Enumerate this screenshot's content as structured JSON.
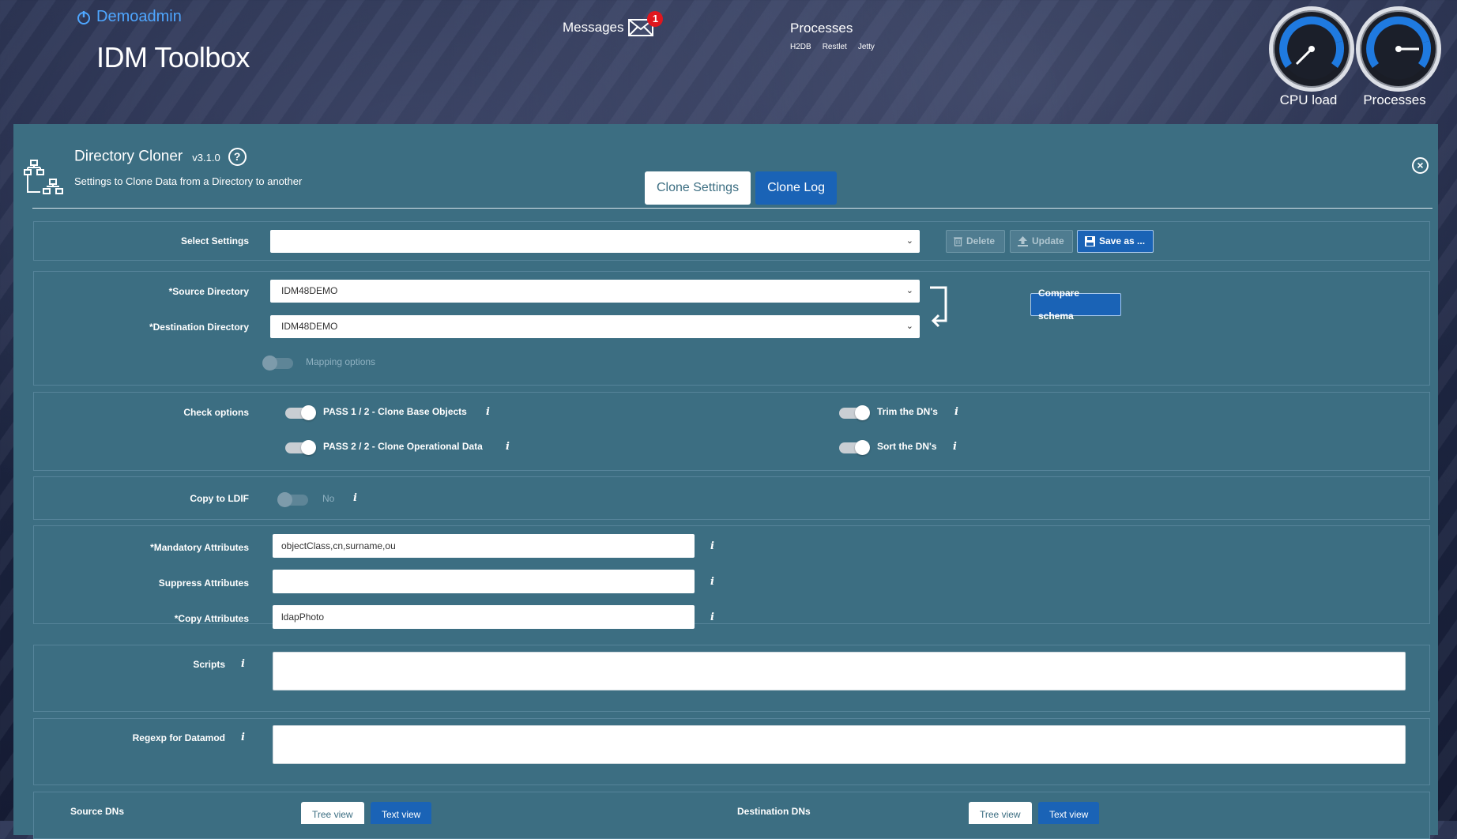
{
  "header": {
    "user": "Demoadmin",
    "app_title": "IDM Toolbox",
    "messages_label": "Messages",
    "messages_count": "1",
    "processes_title": "Processes",
    "process_items": [
      "H2DB",
      "Restlet",
      "Jetty"
    ],
    "gauges": [
      {
        "label": "CPU load",
        "level": 0.2
      },
      {
        "label": "Processes",
        "level": 0.5
      }
    ]
  },
  "module": {
    "title": "Directory Cloner",
    "version": "v3.1.0",
    "subtitle": "Settings to Clone Data from a Directory to another",
    "tabs": [
      "Clone Settings",
      "Clone Log"
    ]
  },
  "settings": {
    "label": "Select Settings",
    "value": "",
    "buttons": {
      "delete": "Delete",
      "update": "Update",
      "save": "Save as ..."
    }
  },
  "directories": {
    "source_label": "*Source Directory",
    "source_value": "IDM48DEMO",
    "destination_label": "*Destination Directory",
    "destination_value": "IDM48DEMO",
    "mapping_label": "Mapping options",
    "compare_button": "Compare schema"
  },
  "check_options": {
    "label": "Check options",
    "items": [
      {
        "label": "PASS 1 / 2 - Clone Base Objects",
        "on": true
      },
      {
        "label": "PASS 2 / 2 - Clone Operational Data",
        "on": true
      },
      {
        "label": "Trim the DN's",
        "on": true
      },
      {
        "label": "Sort the DN's",
        "on": true
      }
    ]
  },
  "ldif": {
    "label": "Copy to LDIF",
    "value": "No"
  },
  "attributes": {
    "mandatory_label": "*Mandatory Attributes",
    "mandatory_value": "objectClass,cn,surname,ou",
    "suppress_label": "Suppress Attributes",
    "suppress_value": "",
    "copy_label": "*Copy Attributes",
    "copy_value": "ldapPhoto"
  },
  "scripts": {
    "label": "Scripts",
    "value": ""
  },
  "regexp": {
    "label": "Regexp for Datamod",
    "value": ""
  },
  "dns": {
    "source_label": "Source DNs",
    "destination_label": "Destination DNs",
    "tree_view": "Tree view",
    "text_view": "Text view"
  },
  "info_glyph": "i",
  "colors": {
    "panel": "#3c6e82",
    "accent": "#1a63b6",
    "user": "#4ea6ff",
    "badge": "#e0161e"
  }
}
